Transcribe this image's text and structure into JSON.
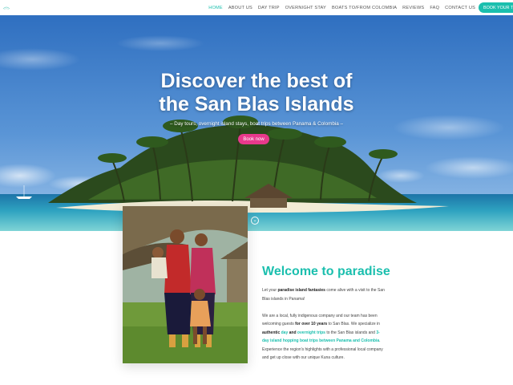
{
  "nav": {
    "items": [
      {
        "label": "HOME",
        "active": true
      },
      {
        "label": "ABOUT US"
      },
      {
        "label": "DAY TRIP"
      },
      {
        "label": "OVERNIGHT STAY"
      },
      {
        "label": "BOATS TO/FROM COLOMBIA"
      },
      {
        "label": "REVIEWS"
      },
      {
        "label": "FAQ"
      },
      {
        "label": "CONTACT US"
      }
    ],
    "book_label": "BOOK YOUR TOUR",
    "logo_icon": "palm-logo-icon"
  },
  "hero": {
    "title_line1": "Discover the best of",
    "title_line2": "the San Blas Islands",
    "subtitle": "– Day tours, overnight island stays, boat trips between Panama & Colombia –",
    "button_label": "Book now",
    "scroll_icon": "chevron-down-icon"
  },
  "welcome": {
    "title": "Welcome to paradise",
    "p1": {
      "a": "Let your ",
      "b": "paradise island fantasies",
      "c": " come alive with a visit to the San Blas islands in Panama!"
    },
    "p2": {
      "a": "We are a local, fully indigenous company and our team has been welcoming guests ",
      "b": "for over 10 years",
      "c": " to San Blas. We specialize in ",
      "d": "authentic",
      "e": " ",
      "f": "day",
      "g": " and ",
      "h": "overnight trips",
      "i": " to the San Blas islands and ",
      "j": "3-day island hopping boat trips between Panama and Colombia",
      "k": ". Experience the region's highlights with a professional local company and get up close with our unique Kuna culture."
    }
  },
  "colors": {
    "accent": "#1bbfae",
    "button_pink": "#e8398c"
  }
}
